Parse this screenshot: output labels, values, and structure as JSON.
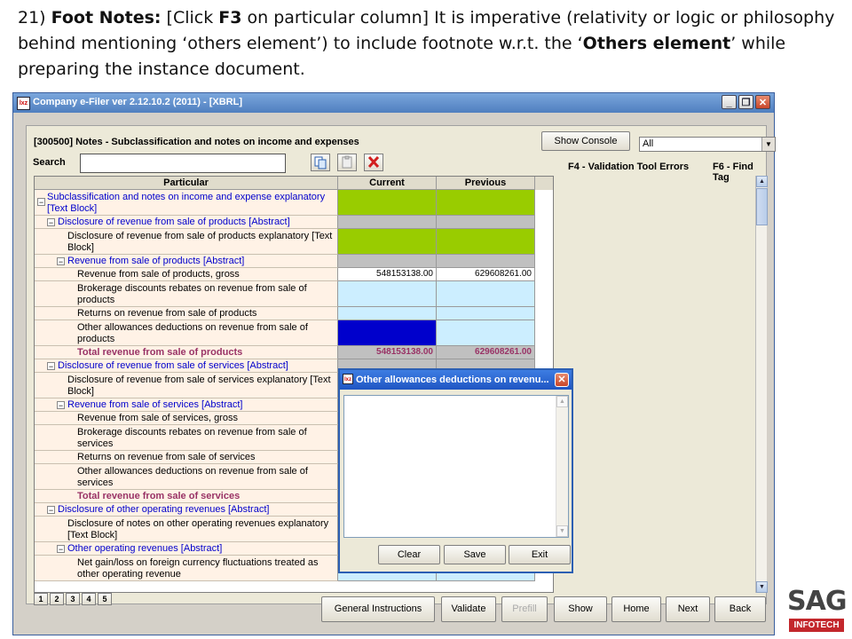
{
  "caption": {
    "num": "21)",
    "label": "Foot Notes:",
    "part1": "[Click ",
    "key": "F3",
    "part2": " on particular column] It is imperative (relativity or logic or philosophy behind mentioning ‘others element’) to include footnote w.r.t. the ‘",
    "bold2": "Others element",
    "part3": "’ while preparing the instance document."
  },
  "window": {
    "title": "Company e-Filer ver 2.12.10.2 (2011) - [XBRL]",
    "min": "_",
    "restore": "❐",
    "close": "✕"
  },
  "header": {
    "title": "[300500] Notes - Subclassification and notes on income and expenses",
    "show_console": "Show Console",
    "filter_value": "All",
    "search_label": "Search",
    "hint_f4": "F4 - Validation Tool Errors",
    "hint_f6": "F6 - Find Tag"
  },
  "grid": {
    "col_particular": "Particular",
    "col_current": "Current",
    "col_previous": "Previous",
    "rows": [
      {
        "label": "Subclassification and notes on income and expense explanatory [Text Block]"
      },
      {
        "label": "Disclosure of revenue from sale of products [Abstract]"
      },
      {
        "label": "Disclosure of revenue from sale of products explanatory [Text Block]"
      },
      {
        "label": "Revenue from sale of products [Abstract]"
      },
      {
        "label": "Revenue from sale of products, gross",
        "current": "548153138.00",
        "previous": "629608261.00"
      },
      {
        "label": "Brokerage discounts rebates on revenue from sale of products"
      },
      {
        "label": "Returns on revenue from sale of products"
      },
      {
        "label": "Other allowances deductions on revenue from sale of products"
      },
      {
        "label": "Total revenue from sale of products",
        "current": "548153138.00",
        "previous": "629608261.00"
      },
      {
        "label": "Disclosure of revenue from sale of services [Abstract]"
      },
      {
        "label": "Disclosure of revenue from sale of services explanatory [Text Block]"
      },
      {
        "label": "Revenue from sale of services [Abstract]"
      },
      {
        "label": "Revenue from sale of services, gross"
      },
      {
        "label": "Brokerage discounts rebates on revenue from sale of services"
      },
      {
        "label": "Returns on revenue from sale of services"
      },
      {
        "label": "Other allowances deductions on revenue from sale of services"
      },
      {
        "label": "Total revenue from sale of services"
      },
      {
        "label": "Disclosure of other operating revenues [Abstract]"
      },
      {
        "label": "Disclosure of notes on other operating revenues explanatory [Text Block]"
      },
      {
        "label": "Other operating revenues [Abstract]"
      },
      {
        "label": "Net gain/loss on foreign currency fluctuations treated as other operating revenue"
      }
    ]
  },
  "pages": [
    "1",
    "2",
    "3",
    "4",
    "5"
  ],
  "footer_buttons": {
    "general": "General Instructions",
    "validate": "Validate",
    "prefill": "Prefill",
    "show": "Show",
    "home": "Home",
    "next": "Next",
    "back": "Back"
  },
  "dialog": {
    "title": "Other allowances deductions on revenu...",
    "close": "✕",
    "clear": "Clear",
    "save": "Save",
    "exit": "Exit"
  },
  "logo": {
    "name": "SAG",
    "sub": "INFOTECH"
  },
  "colors": {
    "green": "#99cc00",
    "light_blue": "#cceeff",
    "selected": "#0000cc",
    "abstract_text": "#0000cc",
    "total_text": "#993366",
    "row_bg": "#fff2e6",
    "gray_cell": "#c0c0c0"
  }
}
